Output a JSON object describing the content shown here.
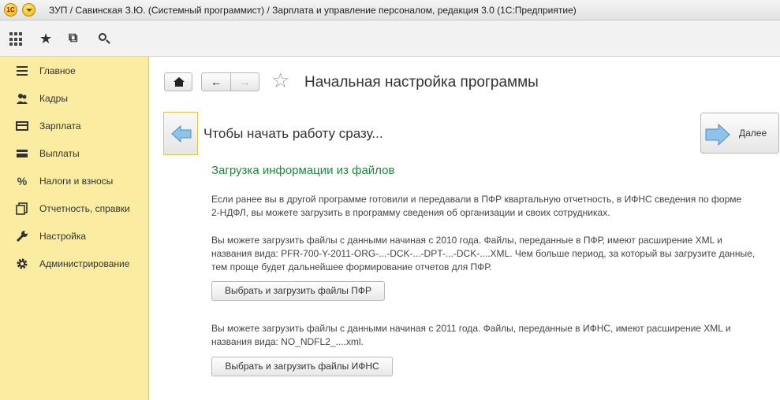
{
  "window": {
    "logo_text": "1С",
    "title": "ЗУП / Савинская З.Ю. (Системный программист) / Зарплата и управление персоналом, редакция 3.0  (1С:Предприятие)"
  },
  "toolbar": {
    "icons": [
      "apps-grid-icon",
      "favorites-star-icon",
      "history-icon",
      "search-icon"
    ]
  },
  "sidebar": {
    "items": [
      {
        "label": "Главное",
        "icon": "menu-lines-icon"
      },
      {
        "label": "Кадры",
        "icon": "people-icon"
      },
      {
        "label": "Зарплата",
        "icon": "salary-icon"
      },
      {
        "label": "Выплаты",
        "icon": "wallet-icon"
      },
      {
        "label": "Налоги и взносы",
        "icon": "percent-icon"
      },
      {
        "label": "Отчетность, справки",
        "icon": "reports-icon"
      },
      {
        "label": "Настройка",
        "icon": "wrench-icon"
      },
      {
        "label": "Администрирование",
        "icon": "gear-icon"
      }
    ]
  },
  "page": {
    "title": "Начальная настройка программы",
    "step_title": "Чтобы начать работу сразу...",
    "next_label": "Далее",
    "section_title": "Загрузка информации из файлов",
    "paragraph1": [
      "Если ранее вы в другой программе готовили и передавали в ПФР квартальную отчетность, в ИФНС сведения по форме",
      "2-НДФЛ, вы можете загрузить в программу сведения об организации и своих сотрудниках."
    ],
    "paragraph2": [
      "Вы можете загрузить файлы с данными начиная с 2010 года. Файлы, переданные в ПФР, имеют расширение XML и",
      "названия вида: PFR-700-Y-2011-ORG-...-DCK-...-DPT-...-DCK-....XML. Чем больше период, за который вы загрузите данные,",
      "тем проще будет дальнейшее формирование отчетов для ПФР."
    ],
    "button_pfr": "Выбрать и загрузить файлы ПФР",
    "paragraph3": [
      "Вы можете загрузить файлы с данными начиная с 2011 года. Файлы, переданные в ИФНС, имеют расширение XML и",
      "названия вида: NO_NDFL2_....xml."
    ],
    "button_ifns": "Выбрать и загрузить файлы ИФНС"
  },
  "colors": {
    "sidebar_bg": "#faeca0",
    "section_title": "#1b8a3a",
    "arrow_blue": "#5a9fd6"
  }
}
